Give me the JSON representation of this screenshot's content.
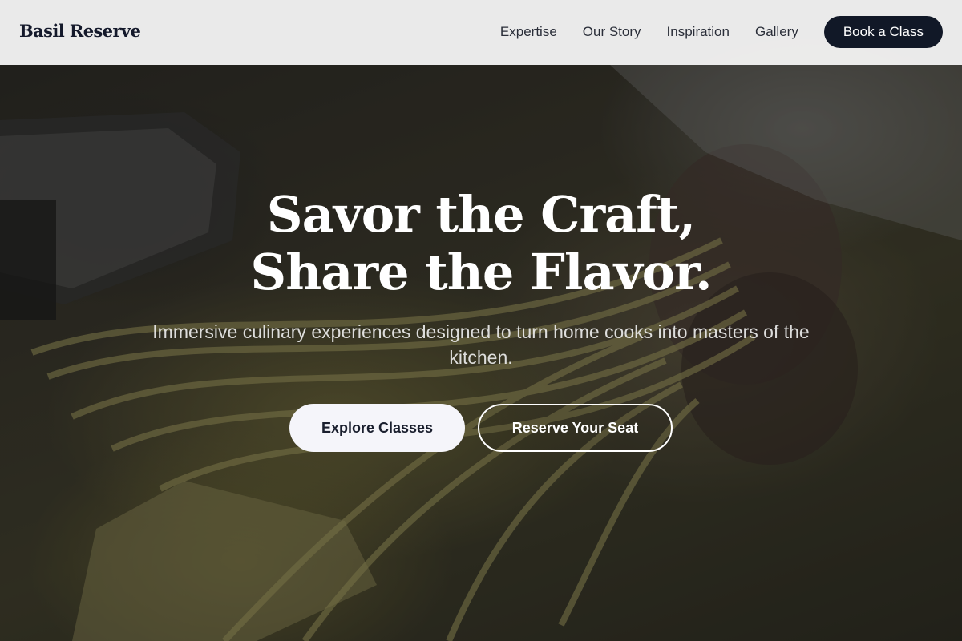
{
  "header": {
    "brand": "Basil Reserve",
    "nav": {
      "expertise": "Expertise",
      "our_story": "Our Story",
      "inspiration": "Inspiration",
      "gallery": "Gallery"
    },
    "cta_label": "Book a Class"
  },
  "hero": {
    "title_line_1": "Savor the Craft,",
    "title_line_2": "Share the Flavor.",
    "subtitle": "Immersive culinary experiences designed to turn home cooks into masters of the kitchen.",
    "primary_button": "Explore Classes",
    "secondary_button": "Reserve Your Seat"
  },
  "colors": {
    "header_bg": "#f3f3f3",
    "brand_text": "#14192b",
    "cta_bg": "#111827",
    "primary_button_bg": "#f5f5fa"
  }
}
